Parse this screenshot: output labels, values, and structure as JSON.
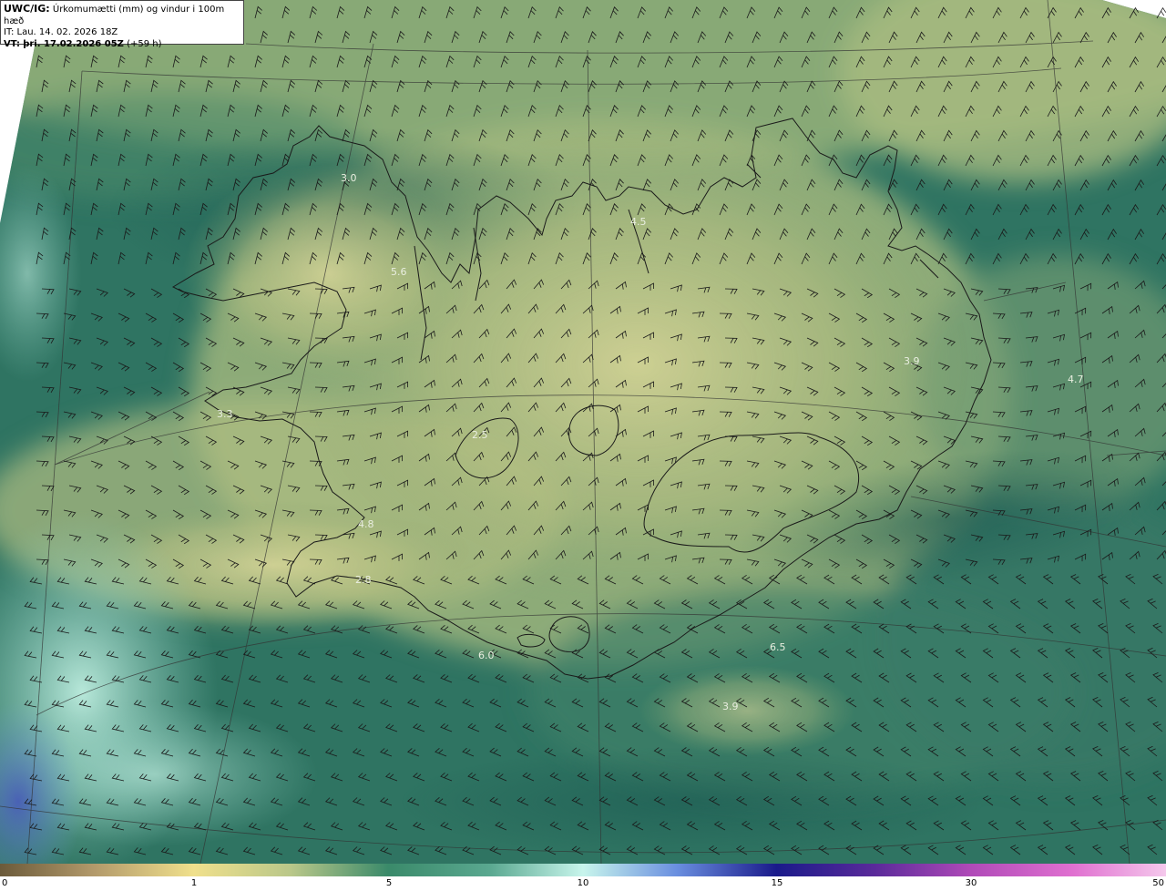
{
  "header": {
    "model_label": "UWC/IG:",
    "product_title": "Úrkomumætti (mm) og vindur i 100m hæð",
    "init_label": "IT:",
    "init_time": "Lau. 14. 02. 2026 18Z",
    "valid_label": "VT:",
    "valid_time": "þri. 17.02.2026 05Z",
    "lead_time": "(+59 h)"
  },
  "colorbar": {
    "ticks": [
      "0",
      "1",
      "5",
      "10",
      "15",
      "30",
      "50"
    ]
  },
  "values": [
    {
      "text": "3.0"
    },
    {
      "text": "5.6"
    },
    {
      "text": "4.5"
    },
    {
      "text": "3.3"
    },
    {
      "text": "2.5"
    },
    {
      "text": "4.8"
    },
    {
      "text": "2.8"
    },
    {
      "text": "6.0"
    },
    {
      "text": "3.9"
    },
    {
      "text": "4.7"
    },
    {
      "text": "6.5"
    },
    {
      "text": "3.9"
    }
  ],
  "colors": {
    "deep_sea": "#1f5f55",
    "mid_green": "#4e8a6a",
    "land_yellow": "#cfd394",
    "light_cyan": "#a8e0d0",
    "blue_edge": "#4460b8"
  }
}
